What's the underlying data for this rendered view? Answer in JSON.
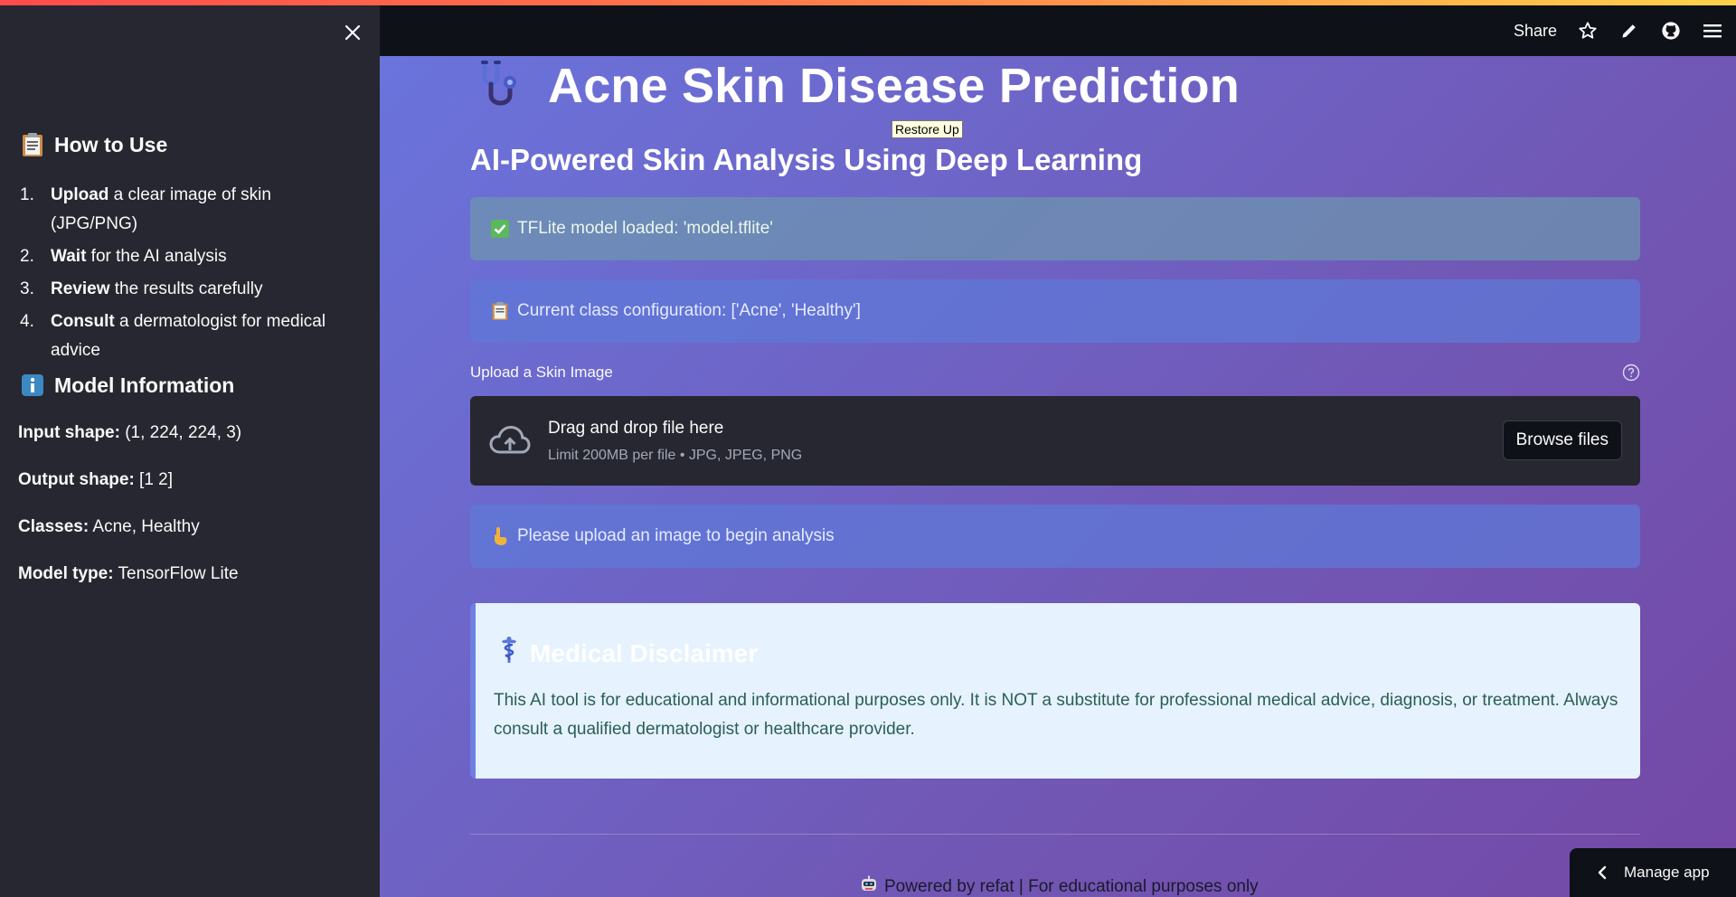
{
  "sidebar": {
    "how_to": {
      "icon": "clipboard-icon",
      "title": "How to Use",
      "steps": [
        {
          "num": "1.",
          "bold": "Upload",
          "rest": " a clear image of skin (JPG/PNG)"
        },
        {
          "num": "2.",
          "bold": "Wait",
          "rest": " for the AI analysis"
        },
        {
          "num": "3.",
          "bold": "Review",
          "rest": " the results carefully"
        },
        {
          "num": "4.",
          "bold": "Consult",
          "rest": " a dermatologist for medical advice"
        }
      ]
    },
    "model_info": {
      "icon": "info-icon",
      "title": "Model Information",
      "rows": [
        {
          "label": "Input shape:",
          "value": " (1, 224, 224, 3)"
        },
        {
          "label": "Output shape:",
          "value": " [1 2]"
        },
        {
          "label": "Classes:",
          "value": " Acne, Healthy"
        },
        {
          "label": "Model type:",
          "value": " TensorFlow Lite"
        }
      ]
    }
  },
  "header": {
    "share_label": "Share",
    "icons": [
      "star-icon",
      "pencil-icon",
      "github-icon",
      "menu-icon"
    ]
  },
  "main": {
    "title": "Acne Skin Disease Prediction",
    "title_icon": "stethoscope-icon",
    "tooltip": "Restore Up",
    "subtitle": "AI-Powered Skin Analysis Using Deep Learning",
    "success_alert": "TFLite model loaded: 'model.tflite'",
    "info_alert": "Current class configuration: ['Acne', 'Healthy']",
    "uploader": {
      "label": "Upload a Skin Image",
      "drop_title": "Drag and drop file here",
      "drop_subtitle": "Limit 200MB per file • JPG, JPEG, PNG",
      "browse_label": "Browse files"
    },
    "upload_prompt": "Please upload an image to begin analysis",
    "disclaimer": {
      "title": "Medical Disclaimer",
      "text": "This AI tool is for educational and informational purposes only. It is NOT a substitute for professional medical advice, diagnosis, or treatment. Always consult a qualified dermatologist or healthcare provider."
    },
    "footer": "Powered by refat | For educational purposes only"
  },
  "manage_app_label": "Manage app",
  "colors": {
    "sidebar_bg": "#262730",
    "header_bg": "#0e1117",
    "main_gradient_start": "#6a74dc",
    "main_gradient_end": "#7448a6",
    "disclaimer_bg": "#e6f2fd",
    "disclaimer_text": "#2a5f55"
  }
}
